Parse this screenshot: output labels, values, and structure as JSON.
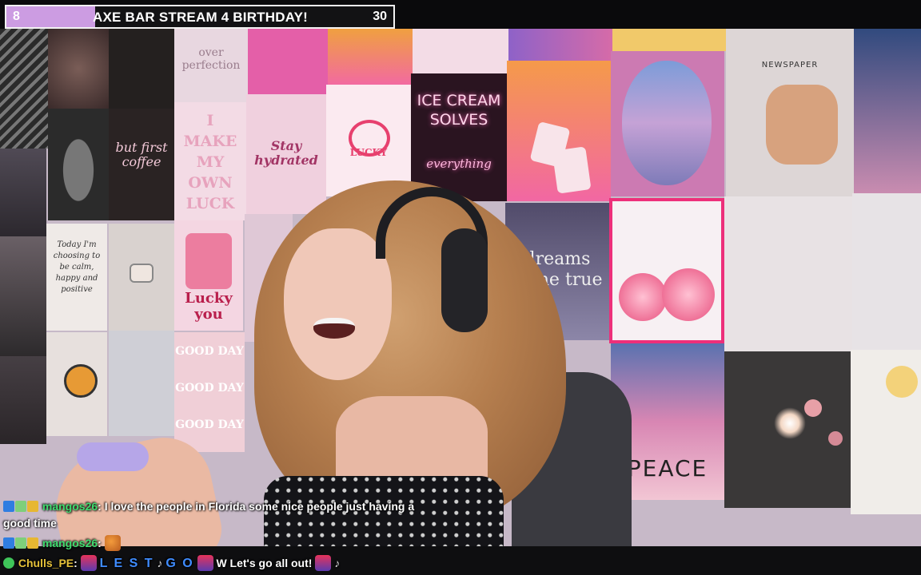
{
  "goal": {
    "start": "8",
    "title": "AXE BAR STREAM 4 BIRTHDAY!",
    "target": "30",
    "progress_fraction": 0.23,
    "fill_color": "#cc9ce2"
  },
  "wall": {
    "tiles": {
      "over_perfection": "over perfection",
      "ice_cream": "ICE CREAM SOLVES",
      "everything": "everything",
      "i_make": "I MAKE MY OWN LUCK",
      "stay_hydrated": "Stay hydrated",
      "lucky": "LUCKY",
      "but_first": "but first coffee",
      "today": "Today I'm choosing to be calm, happy and positive",
      "lucky_you": "Lucky you",
      "dreams": "dreams come true",
      "good_day_1": "GOOD DAY",
      "good_day_2": "GOOD DAY",
      "good_day_3": "GOOD DAY",
      "peace": "PEACE",
      "newspaper": "NEWSPAPER"
    }
  },
  "chat": {
    "messages": [
      {
        "user": "mangos26",
        "user_color": "#3fdc6f",
        "separator": ":",
        "text": "I love the people in Florida some nice people just having a",
        "text_cont": "good time"
      },
      {
        "user": "mangos26",
        "user_color": "#3fdc6f",
        "separator": ":",
        "emote": "rooster-emote"
      },
      {
        "user": "Chulls_PE",
        "user_color": "#e5c13a",
        "separator": ":",
        "letters_1": "L E S T",
        "letters_2": "G O",
        "text": "W Let's go all out!"
      }
    ]
  }
}
